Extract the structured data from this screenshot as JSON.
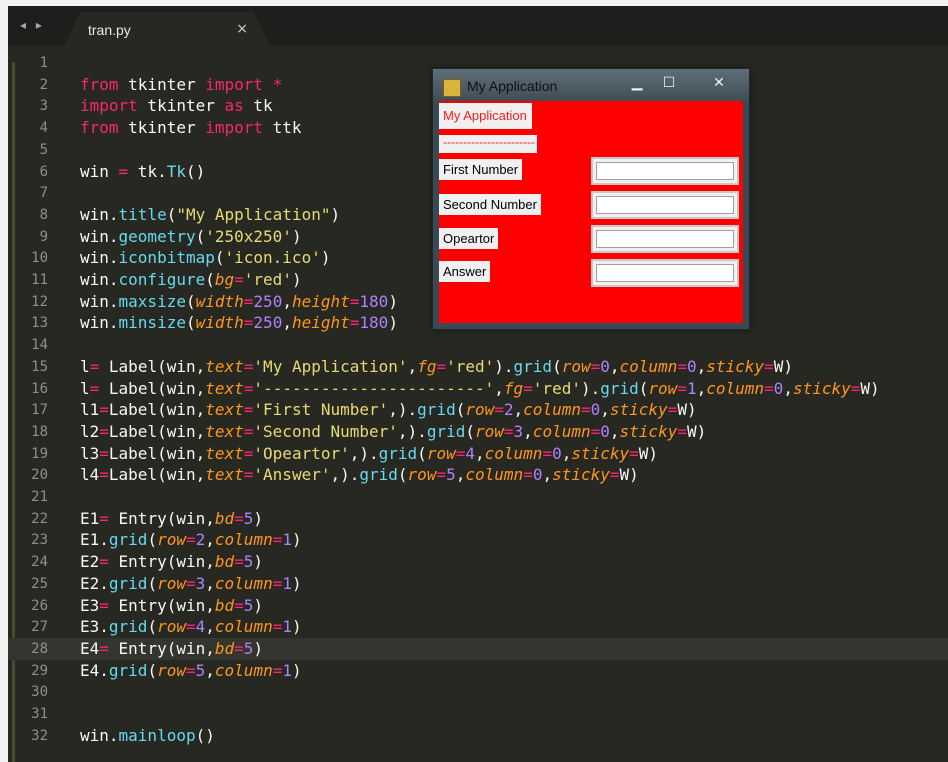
{
  "tab": {
    "filename": "tran.py",
    "close": "×",
    "nav": "◂ ▸"
  },
  "code": [
    {
      "n": "1",
      "html": ""
    },
    {
      "n": "2",
      "html": "<span class='kw'>from</span> tkinter <span class='kw'>import</span> <span class='kw'>*</span>"
    },
    {
      "n": "3",
      "html": "<span class='kw'>import</span> tkinter <span class='kw'>as</span> tk"
    },
    {
      "n": "4",
      "html": "<span class='kw'>from</span> tkinter <span class='kw'>import</span> ttk"
    },
    {
      "n": "5",
      "html": ""
    },
    {
      "n": "6",
      "html": "win <span class='kw'>=</span> tk.<span class='fn'>Tk</span>()"
    },
    {
      "n": "7",
      "html": ""
    },
    {
      "n": "8",
      "html": "win.<span class='fn'>title</span>(<span class='st'>\"My Application\"</span>)"
    },
    {
      "n": "9",
      "html": "win.<span class='fn'>geometry</span>(<span class='st'>'250x250'</span>)"
    },
    {
      "n": "10",
      "html": "win.<span class='fn'>iconbitmap</span>(<span class='st'>'icon.ico'</span>)"
    },
    {
      "n": "11",
      "html": "win.<span class='fn'>configure</span>(<span class='pa'>bg</span><span class='kw'>=</span><span class='st'>'red'</span>)"
    },
    {
      "n": "12",
      "html": "win.<span class='fn'>maxsize</span>(<span class='pa'>width</span><span class='kw'>=</span><span class='nu'>250</span>,<span class='pa'>height</span><span class='kw'>=</span><span class='nu'>180</span>)"
    },
    {
      "n": "13",
      "html": "win.<span class='fn'>minsize</span>(<span class='pa'>width</span><span class='kw'>=</span><span class='nu'>250</span>,<span class='pa'>height</span><span class='kw'>=</span><span class='nu'>180</span>)"
    },
    {
      "n": "14",
      "html": ""
    },
    {
      "n": "15",
      "html": "l<span class='kw'>=</span> Label(win,<span class='pa'>text</span><span class='kw'>=</span><span class='st'>'My Application'</span>,<span class='pa'>fg</span><span class='kw'>=</span><span class='st'>'red'</span>).<span class='fn'>grid</span>(<span class='pa'>row</span><span class='kw'>=</span><span class='nu'>0</span>,<span class='pa'>column</span><span class='kw'>=</span><span class='nu'>0</span>,<span class='pa'>sticky</span><span class='kw'>=</span>W)"
    },
    {
      "n": "16",
      "html": "l<span class='kw'>=</span> Label(win,<span class='pa'>text</span><span class='kw'>=</span><span class='st'>'-----------------------'</span>,<span class='pa'>fg</span><span class='kw'>=</span><span class='st'>'red'</span>).<span class='fn'>grid</span>(<span class='pa'>row</span><span class='kw'>=</span><span class='nu'>1</span>,<span class='pa'>column</span><span class='kw'>=</span><span class='nu'>0</span>,<span class='pa'>sticky</span><span class='kw'>=</span>W)"
    },
    {
      "n": "17",
      "html": "l1<span class='kw'>=</span>Label(win,<span class='pa'>text</span><span class='kw'>=</span><span class='st'>'First Number'</span>,).<span class='fn'>grid</span>(<span class='pa'>row</span><span class='kw'>=</span><span class='nu'>2</span>,<span class='pa'>column</span><span class='kw'>=</span><span class='nu'>0</span>,<span class='pa'>sticky</span><span class='kw'>=</span>W)"
    },
    {
      "n": "18",
      "html": "l2<span class='kw'>=</span>Label(win,<span class='pa'>text</span><span class='kw'>=</span><span class='st'>'Second Number'</span>,).<span class='fn'>grid</span>(<span class='pa'>row</span><span class='kw'>=</span><span class='nu'>3</span>,<span class='pa'>column</span><span class='kw'>=</span><span class='nu'>0</span>,<span class='pa'>sticky</span><span class='kw'>=</span>W)"
    },
    {
      "n": "19",
      "html": "l3<span class='kw'>=</span>Label(win,<span class='pa'>text</span><span class='kw'>=</span><span class='st'>'Opeartor'</span>,).<span class='fn'>grid</span>(<span class='pa'>row</span><span class='kw'>=</span><span class='nu'>4</span>,<span class='pa'>column</span><span class='kw'>=</span><span class='nu'>0</span>,<span class='pa'>sticky</span><span class='kw'>=</span>W)"
    },
    {
      "n": "20",
      "html": "l4<span class='kw'>=</span>Label(win,<span class='pa'>text</span><span class='kw'>=</span><span class='st'>'Answer'</span>,).<span class='fn'>grid</span>(<span class='pa'>row</span><span class='kw'>=</span><span class='nu'>5</span>,<span class='pa'>column</span><span class='kw'>=</span><span class='nu'>0</span>,<span class='pa'>sticky</span><span class='kw'>=</span>W)"
    },
    {
      "n": "21",
      "html": ""
    },
    {
      "n": "22",
      "html": "E1<span class='kw'>=</span> Entry(win,<span class='pa'>bd</span><span class='kw'>=</span><span class='nu'>5</span>)"
    },
    {
      "n": "23",
      "html": "E1.<span class='fn'>grid</span>(<span class='pa'>row</span><span class='kw'>=</span><span class='nu'>2</span>,<span class='pa'>column</span><span class='kw'>=</span><span class='nu'>1</span>)"
    },
    {
      "n": "24",
      "html": "E2<span class='kw'>=</span> Entry(win,<span class='pa'>bd</span><span class='kw'>=</span><span class='nu'>5</span>)"
    },
    {
      "n": "25",
      "html": "E2.<span class='fn'>grid</span>(<span class='pa'>row</span><span class='kw'>=</span><span class='nu'>3</span>,<span class='pa'>column</span><span class='kw'>=</span><span class='nu'>1</span>)"
    },
    {
      "n": "26",
      "html": "E3<span class='kw'>=</span> Entry(win,<span class='pa'>bd</span><span class='kw'>=</span><span class='nu'>5</span>)"
    },
    {
      "n": "27",
      "html": "E3.<span class='fn'>grid</span>(<span class='pa'>row</span><span class='kw'>=</span><span class='nu'>4</span>,<span class='pa'>column</span><span class='kw'>=</span><span class='nu'>1</span>)"
    },
    {
      "n": "28",
      "html": "E4<span class='kw'>=</span> Entry(win,<span class='pa'>bd</span><span class='kw'>=</span><span class='nu'>5</span>)",
      "active": true
    },
    {
      "n": "29",
      "html": "E4.<span class='fn'>grid</span>(<span class='pa'>row</span><span class='kw'>=</span><span class='nu'>5</span>,<span class='pa'>column</span><span class='kw'>=</span><span class='nu'>1</span>)"
    },
    {
      "n": "30",
      "html": ""
    },
    {
      "n": "31",
      "html": ""
    },
    {
      "n": "32",
      "html": "win.<span class='fn'>mainloop</span>()"
    }
  ],
  "tkwindow": {
    "title": "My Application",
    "minimize": "▁",
    "maximize": "☐",
    "close": "✕",
    "heading": "My Application",
    "divider": "-----------------------",
    "labels": [
      "First Number",
      "Second Number",
      "Opeartor",
      "Answer"
    ]
  }
}
